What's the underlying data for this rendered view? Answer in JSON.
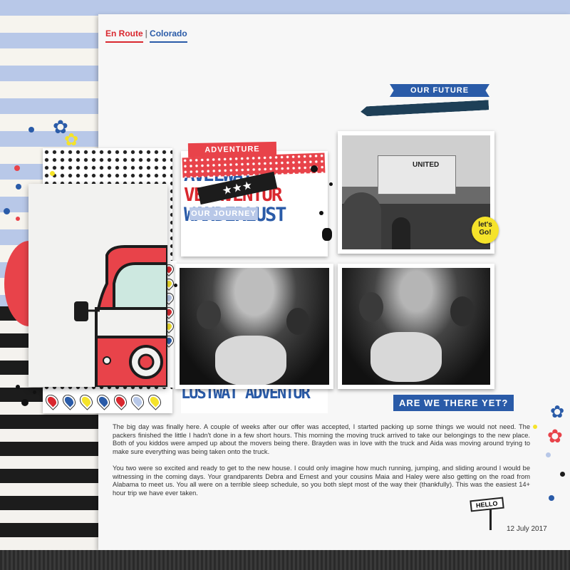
{
  "page_title": {
    "place": "En Route",
    "separator": "|",
    "region": "Colorado"
  },
  "labels": {
    "our_future": "OUR FUTURE",
    "adventure_awaits": "ADVENTURE AWAITS",
    "our_journey": "OUR JOURNEY",
    "lets_go": "let's Go!",
    "are_we_there_yet": "ARE WE THERE YET?",
    "hello_sign": "HELLO"
  },
  "word_art": {
    "lines": [
      "AVELWAT",
      "VELAVENTUR",
      "WANDERLUST"
    ],
    "bottom_line": "LUSTWAT ADVENTUR"
  },
  "truck_label": "UNITED",
  "journal": {
    "paragraphs": [
      "The big day was finally here. A couple of weeks after our offer was accepted, I started packing up some things we would not need. The packers finished the little I hadn't done in a few short hours. This morning the moving truck arrived to take our belongings to the new place. Both of you kiddos were amped up about the movers being there. Brayden was in love with the truck and Aida was moving around trying to make sure everything was being taken onto the truck.",
      "You two were so excited and ready to get to the new house. I could only imagine how much running, jumping, and sliding around I would be witnessing in the coming days. Your grandparents Debra and Ernest and your cousins Maia and Haley were also getting on the road from Alabama to meet us. You all were on a terrible sleep schedule, so you both slept most of the way their (thankfully). This was the easiest 14+ hour trip we have ever taken."
    ],
    "date": "12 July 2017"
  },
  "colors": {
    "red": "#d9272e",
    "blue": "#2a5ba8",
    "yellow": "#f5e32a",
    "dark": "#1c1c1c"
  }
}
